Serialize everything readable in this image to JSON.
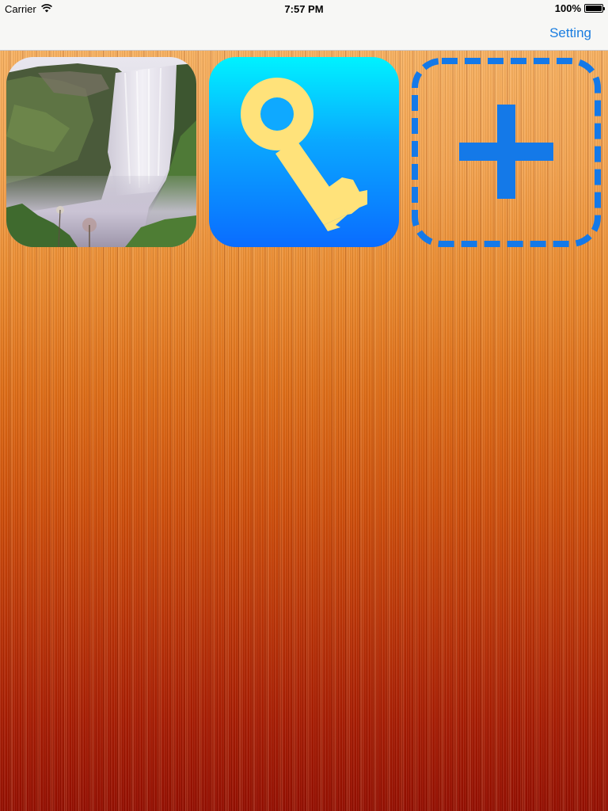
{
  "status_bar": {
    "carrier": "Carrier",
    "time": "7:57 PM",
    "battery_text": "100%",
    "battery_level": 1.0
  },
  "nav": {
    "setting_label": "Setting"
  },
  "tiles": [
    {
      "kind": "photo",
      "icon": "waterfall-photo"
    },
    {
      "kind": "app",
      "icon": "key-icon"
    },
    {
      "kind": "add",
      "icon": "plus-icon"
    }
  ],
  "colors": {
    "accent": "#1a7de0",
    "add_tile": "#1479e8",
    "key": "#ffe27a"
  }
}
